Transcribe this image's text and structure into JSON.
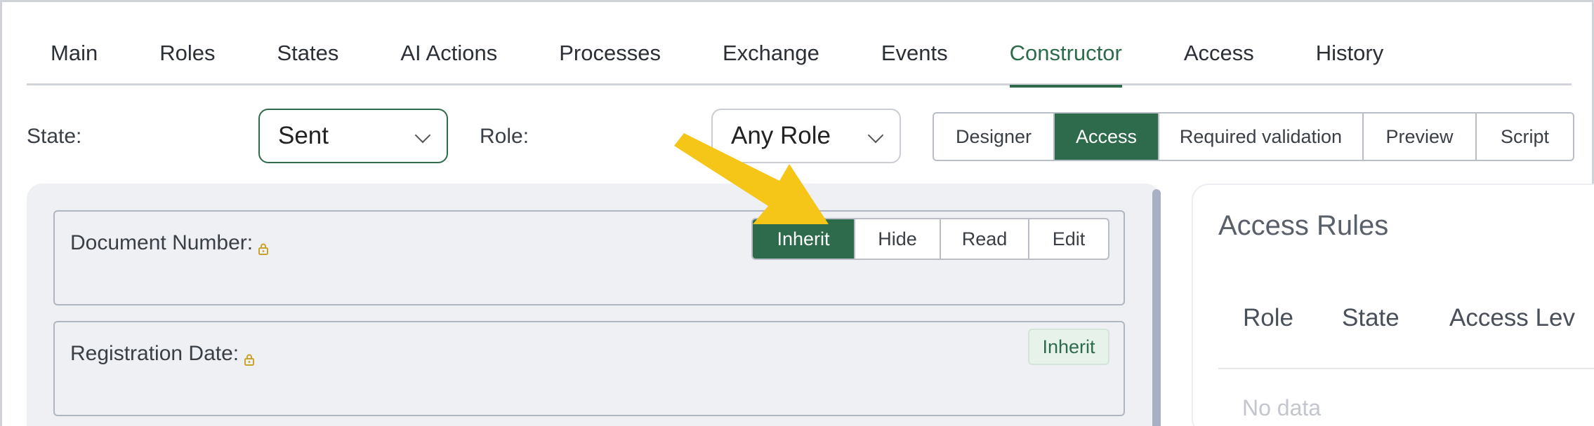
{
  "tabs": [
    {
      "label": "Main"
    },
    {
      "label": "Roles"
    },
    {
      "label": "States"
    },
    {
      "label": "AI Actions"
    },
    {
      "label": "Processes"
    },
    {
      "label": "Exchange"
    },
    {
      "label": "Events"
    },
    {
      "label": "Constructor",
      "active": true
    },
    {
      "label": "Access"
    },
    {
      "label": "History"
    }
  ],
  "toolbar": {
    "state_label": "State:",
    "state_value": "Sent",
    "role_label": "Role:",
    "role_value": "Any Role",
    "modes": [
      "Designer",
      "Access",
      "Required validation",
      "Preview",
      "Script"
    ],
    "active_mode": "Access"
  },
  "fields": [
    {
      "label": "Document Number:",
      "access_options": [
        "Inherit",
        "Hide",
        "Read",
        "Edit"
      ],
      "selected": "Inherit"
    },
    {
      "label": "Registration Date:",
      "badge": "Inherit"
    }
  ],
  "access_rules": {
    "title": "Access Rules",
    "columns": [
      "Role",
      "State",
      "Access Lev"
    ],
    "empty_text": "No data"
  },
  "colors": {
    "accent": "#2e6b4c",
    "arrow": "#f5c518",
    "lock": "#c9a227"
  }
}
